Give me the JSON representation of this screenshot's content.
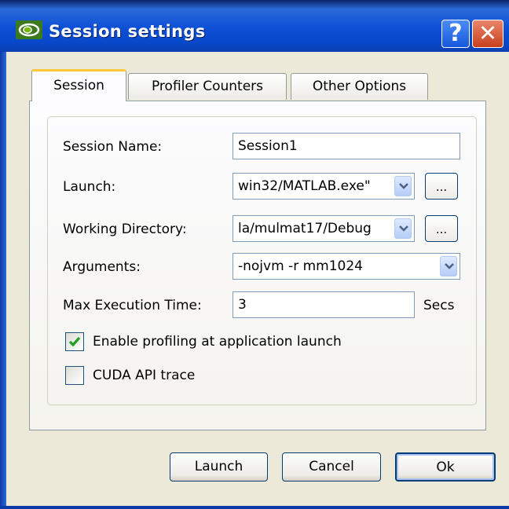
{
  "window": {
    "title": "Session settings",
    "help_glyph": "?",
    "close_glyph": "✕"
  },
  "tabs": [
    {
      "label": "Session",
      "active": true
    },
    {
      "label": "Profiler Counters",
      "active": false
    },
    {
      "label": "Other Options",
      "active": false
    }
  ],
  "form": {
    "session_name": {
      "label": "Session Name:",
      "value": "Session1"
    },
    "launch": {
      "label": "Launch:",
      "value": "win32/MATLAB.exe\"",
      "browse_label": "..."
    },
    "working_directory": {
      "label": "Working Directory:",
      "value": "la/mulmat17/Debug",
      "browse_label": "..."
    },
    "arguments": {
      "label": "Arguments:",
      "value": "-nojvm -r mm1024"
    },
    "max_execution_time": {
      "label": "Max Execution Time:",
      "value": "3",
      "unit": "Secs"
    },
    "enable_profiling": {
      "label": "Enable profiling at application launch",
      "checked": true
    },
    "cuda_api_trace": {
      "label": "CUDA API trace",
      "checked": false
    }
  },
  "buttons": {
    "launch": "Launch",
    "cancel": "Cancel",
    "ok": "Ok"
  },
  "icons": {
    "title_icon": "nvidia-logo-icon",
    "dropdown": "chevron-down-icon",
    "checkmark": "checkmark-icon"
  },
  "colors": {
    "titlebar": "#0c4fd6",
    "dialog_background": "#ece9d8",
    "active_tab_highlight": "#ffc83c",
    "checkmark": "#21a121"
  }
}
